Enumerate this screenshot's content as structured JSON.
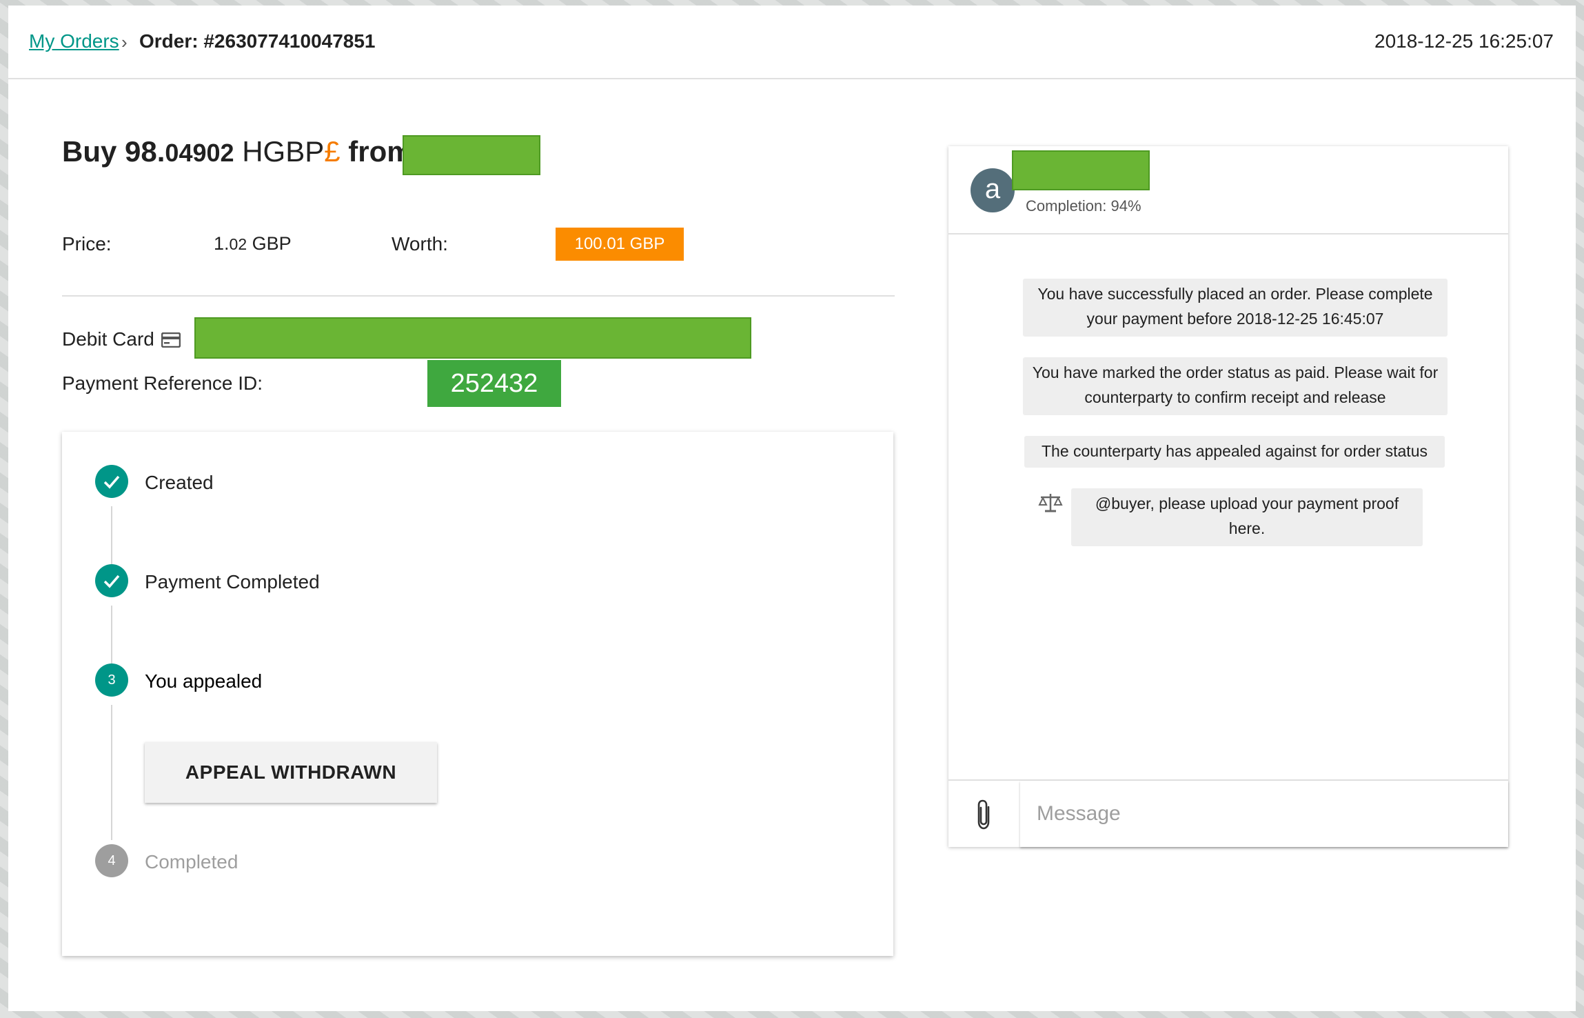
{
  "breadcrumb": {
    "parent": "My Orders",
    "separator": "›",
    "current": "Order: #263077410047851"
  },
  "timestamp": "2018-12-25 16:25:07",
  "order": {
    "buy_word": "Buy",
    "amount_int": "98.",
    "amount_dec": "04902",
    "currency": "HGBP",
    "currency_symbol": "£",
    "from_word": "from",
    "price_label": "Price:",
    "price_int": "1.",
    "price_dec": "02",
    "price_currency": "GBP",
    "worth_label": "Worth:",
    "worth_value": "100.01 GBP",
    "payment_method": "Debit Card",
    "payment_ref_label": "Payment Reference ID:",
    "payment_ref_value": "252432"
  },
  "steps": [
    {
      "number": "",
      "label": "Created",
      "state": "done"
    },
    {
      "number": "",
      "label": "Payment Completed",
      "state": "done"
    },
    {
      "number": "3",
      "label": "You appealed",
      "state": "active"
    },
    {
      "number": "4",
      "label": "Completed",
      "state": "pending"
    }
  ],
  "appeal_button": "APPEAL WITHDRAWN",
  "chat": {
    "avatar_letter": "a",
    "completion": "Completion: 94%",
    "messages": [
      "You have successfully placed an order. Please complete your payment before 2018-12-25 16:45:07",
      "You have marked the order status as paid. Please wait for counterparty to confirm receipt and release",
      "The counterparty has appealed against for order status",
      "@buyer, please upload your payment proof here."
    ],
    "input_placeholder": "Message"
  },
  "colors": {
    "accent": "#009688",
    "worth_badge": "#fb8c00",
    "ref_badge": "#3fa83f",
    "redaction": "#6ab534"
  }
}
